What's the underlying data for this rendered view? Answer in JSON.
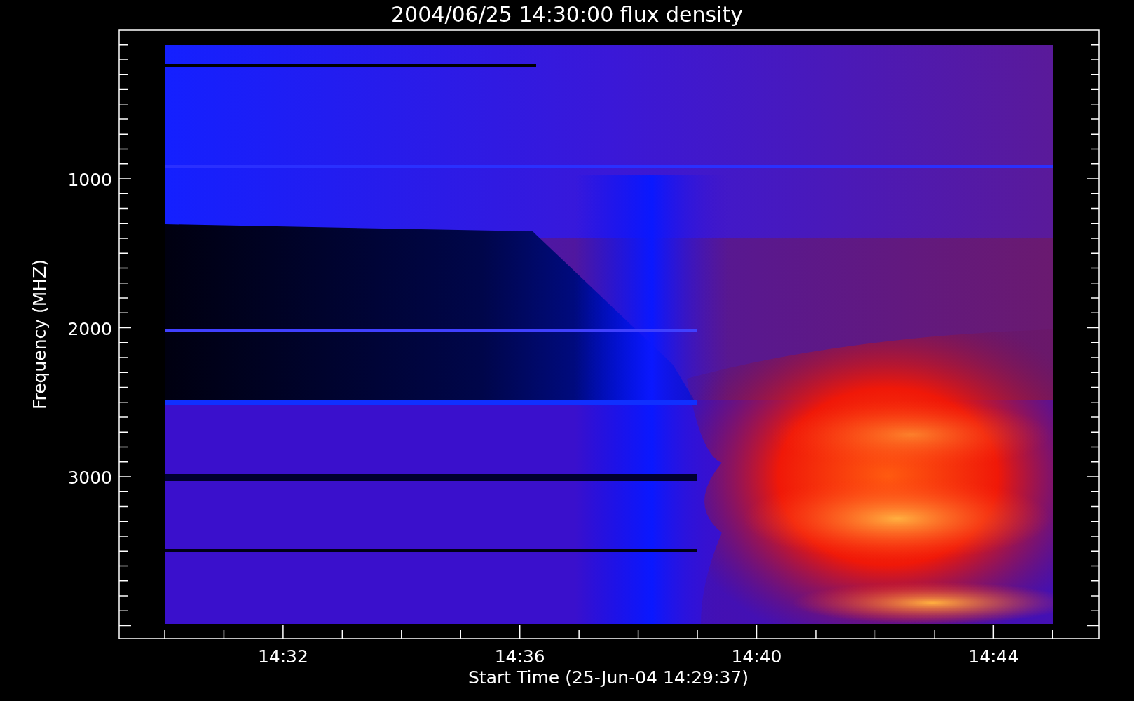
{
  "title": "2004/06/25 14:30:00 flux density",
  "x_axis": {
    "label": "Start Time (25-Jun-04 14:29:37)",
    "ticks": [
      "14:32",
      "14:36",
      "14:40",
      "14:44"
    ]
  },
  "y_axis": {
    "label": "Frequency (MHZ)",
    "ticks": [
      "1000",
      "2000",
      "3000"
    ]
  }
}
